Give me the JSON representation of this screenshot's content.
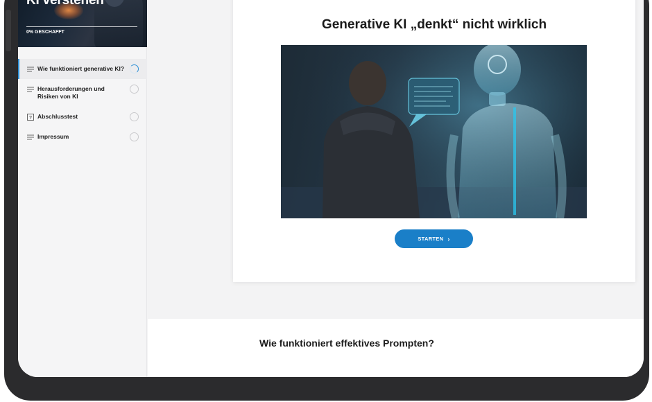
{
  "course": {
    "title": "KI verstehen",
    "progress_label": "0% GESCHAFFT",
    "progress_fraction": 0
  },
  "nav": {
    "items": [
      {
        "label": "Wie funktioniert generative KI?",
        "icon": "lesson-lines-icon",
        "status": "in-progress"
      },
      {
        "label": "Herausforderungen und Risiken von KI",
        "icon": "lesson-lines-icon",
        "status": "not-started"
      },
      {
        "label": "Abschlusstest",
        "icon": "quiz-question-icon",
        "status": "not-started"
      },
      {
        "label": "Impressum",
        "icon": "lesson-lines-icon",
        "status": "not-started"
      }
    ]
  },
  "lesson": {
    "title": "Generative KI „denkt“ nicht wirklich",
    "start_label": "STARTEN",
    "hero_image": "person-facing-holographic-robot-with-speech-bubble"
  },
  "next_section": {
    "title": "Wie funktioniert effektives Prompten?"
  },
  "colors": {
    "accent": "#1a7fc8",
    "active_indicator": "#2c8fd6",
    "frame": "#2b2b2d"
  }
}
